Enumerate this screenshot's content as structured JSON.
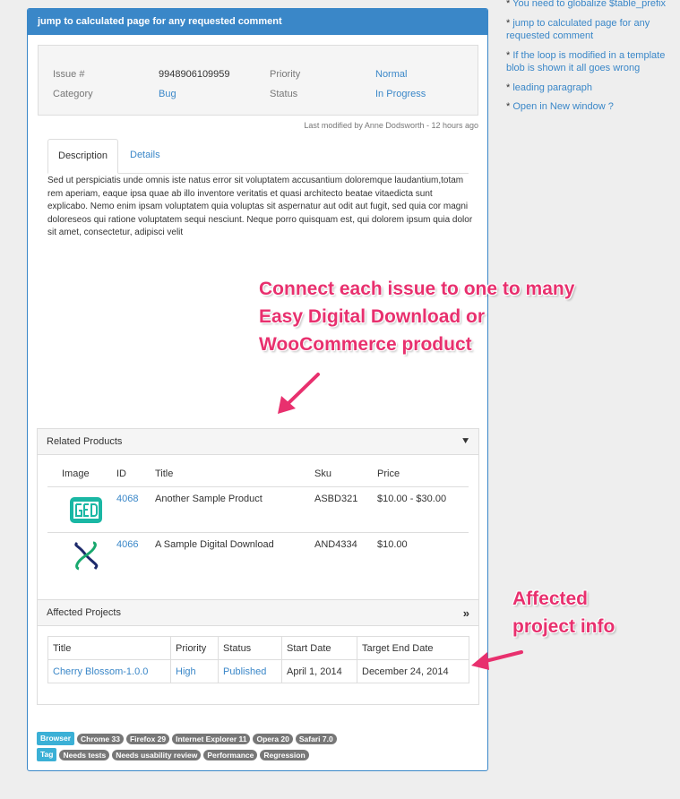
{
  "panel": {
    "title": "jump to calculated page for any requested comment"
  },
  "meta": {
    "issue_label": "Issue #",
    "issue_value": "9948906109959",
    "priority_label": "Priority",
    "priority_value": "Normal",
    "category_label": "Category",
    "category_value": "Bug",
    "status_label": "Status",
    "status_value": "In Progress"
  },
  "modified": "Last modified by Anne Dodsworth - 12 hours ago",
  "tabs": [
    {
      "label": "Description"
    },
    {
      "label": "Details"
    }
  ],
  "description": "Sed ut perspiciatis unde omnis iste natus error sit voluptatem accusantium doloremque laudantium,totam rem aperiam, eaque ipsa quae ab illo inventore veritatis et quasi architecto beatae vitaedicta sunt explicabo. Nemo enim ipsam voluptatem quia voluptas sit aspernatur aut odit aut fugit, sed quia cor magni doloreseos qui ratione voluptatem sequi nesciunt. Neque porro quisquam est, qui dolorem ipsum quia dolor sit amet, consectetur, adipisci velit",
  "annotations": {
    "connect_line1": "Connect each issue to one to many",
    "connect_line2": "Easy Digital Download or",
    "connect_line3": "WooCommerce product",
    "affected_line1": "Affected",
    "affected_line2": "project info"
  },
  "related_products": {
    "title": "Related Products",
    "headers": [
      "Image",
      "ID",
      "Title",
      "Sku",
      "Price"
    ],
    "rows": [
      {
        "id": "4068",
        "title": "Another Sample Product",
        "sku": "ASBD321",
        "price": "$10.00 - $30.00"
      },
      {
        "id": "4066",
        "title": "A Sample Digital Download",
        "sku": "AND4334",
        "price": "$10.00"
      }
    ]
  },
  "affected_projects": {
    "title": "Affected Projects",
    "headers": [
      "Title",
      "Priority",
      "Status",
      "Start Date",
      "Target End Date"
    ],
    "row": {
      "title": "Cherry Blossom-1.0.0",
      "priority": "High",
      "status": "Published",
      "start": "April 1, 2014",
      "end": "December 24, 2014"
    }
  },
  "tags": {
    "browser_label": "Browser",
    "browsers": [
      "Chrome 33",
      "Firefox 29",
      "Internet Explorer 11",
      "Opera 20",
      "Safari 7.0"
    ],
    "tag_label": "Tag",
    "tags": [
      "Needs tests",
      "Needs usability review",
      "Performance",
      "Regression"
    ]
  },
  "sidebar": {
    "items": [
      "You need to globalize $table_prefix",
      "jump to calculated page for any requested comment",
      "If the loop is modified in a template blob is shown it all goes wrong",
      "leading paragraph",
      "Open in New window ?"
    ]
  },
  "colors": {
    "accent": "#3a87c8",
    "annotation": "#e8306e",
    "tag_label": "#3bb0d6",
    "tag": "#777777"
  }
}
